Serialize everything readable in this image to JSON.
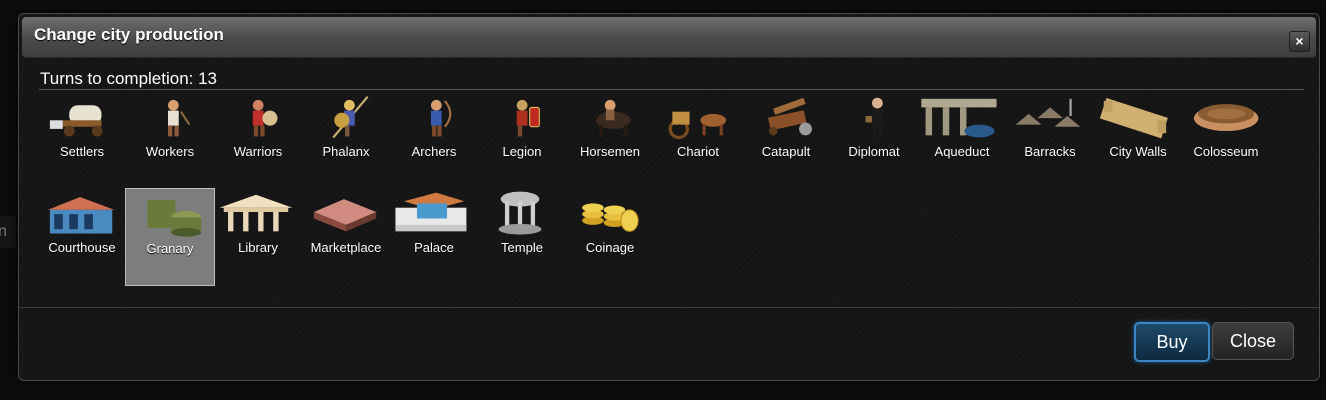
{
  "background": {
    "fragment_text": "n"
  },
  "dialog": {
    "title": "Change city production",
    "close_symbol": "×",
    "turns_text": "Turns to completion: 13",
    "selected_item": "Granary",
    "rows": [
      [
        {
          "label": "Settlers",
          "icon": "settlers-icon"
        },
        {
          "label": "Workers",
          "icon": "workers-icon"
        },
        {
          "label": "Warriors",
          "icon": "warriors-icon"
        },
        {
          "label": "Phalanx",
          "icon": "phalanx-icon"
        },
        {
          "label": "Archers",
          "icon": "archers-icon"
        },
        {
          "label": "Legion",
          "icon": "legion-icon"
        },
        {
          "label": "Horsemen",
          "icon": "horsemen-icon"
        },
        {
          "label": "Chariot",
          "icon": "chariot-icon"
        },
        {
          "label": "Catapult",
          "icon": "catapult-icon"
        },
        {
          "label": "Diplomat",
          "icon": "diplomat-icon"
        },
        {
          "label": "Aqueduct",
          "icon": "aqueduct-icon"
        },
        {
          "label": "Barracks",
          "icon": "barracks-icon"
        },
        {
          "label": "City Walls",
          "icon": "city-walls-icon"
        },
        {
          "label": "Colosseum",
          "icon": "colosseum-icon"
        }
      ],
      [
        {
          "label": "Courthouse",
          "icon": "courthouse-icon"
        },
        {
          "label": "Granary",
          "icon": "granary-icon"
        },
        {
          "label": "Library",
          "icon": "library-icon"
        },
        {
          "label": "Marketplace",
          "icon": "marketplace-icon"
        },
        {
          "label": "Palace",
          "icon": "palace-icon"
        },
        {
          "label": "Temple",
          "icon": "temple-icon"
        },
        {
          "label": "Coinage",
          "icon": "coinage-icon"
        }
      ]
    ],
    "buttons": {
      "buy": "Buy",
      "close": "Close"
    }
  },
  "colors": {
    "accent": "#3a86c4",
    "selected_bg": "#7d7d7d",
    "dialog_bg": "#161616"
  }
}
